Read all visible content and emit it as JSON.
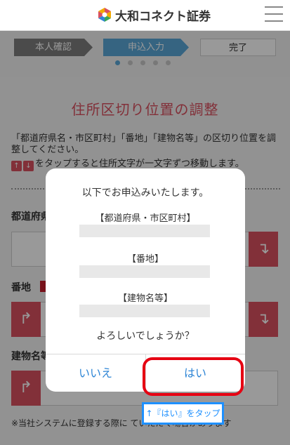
{
  "header": {
    "brand": "大和コネクト証券",
    "logo_icon": "daiwa-logo-icon",
    "menu_icon": "hamburger-menu-icon"
  },
  "steps": {
    "items": [
      {
        "label": "本人確認",
        "state": "done"
      },
      {
        "label": "申込入力",
        "state": "current"
      },
      {
        "label": "完了",
        "state": "pending"
      }
    ],
    "pager_total": 5,
    "pager_active": 1
  },
  "main": {
    "title": "住所区切り位置の調整",
    "description": "「都道府県名・市区町村」「番地」「建物名等」の区切り位置を調整してください。",
    "description2": "をタップすると住所文字が一文字ずつ移動します。",
    "fields": {
      "prefecture_label": "都道府県",
      "banchi_label": "番地",
      "building_label": "建物名等"
    },
    "note": "※当社システムに登録する際に   ていただく場合があります",
    "arrows": {
      "up": "↑",
      "down": "↓"
    }
  },
  "dialog": {
    "message": "以下でお申込みいたします。",
    "label_prefecture": "【都道府県・市区町村】",
    "label_banchi": "【番地】",
    "label_building": "【建物名等】",
    "confirm": "よろしいでしょうか？",
    "no_label": "いいえ",
    "yes_label": "はい"
  },
  "annotation": {
    "callout": "↑『はい』をタップ"
  },
  "colors": {
    "accent": "#d9505f",
    "step_current": "#5aa7d8",
    "link_blue": "#2f86d6",
    "highlight_red": "#e60012",
    "callout_blue": "#1e90ff"
  }
}
